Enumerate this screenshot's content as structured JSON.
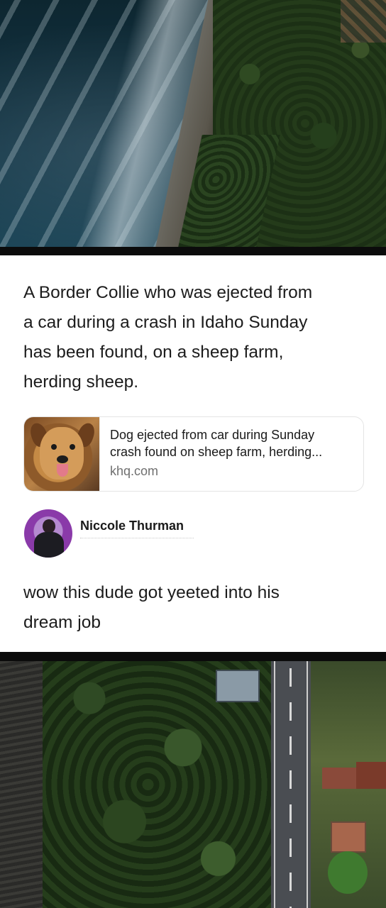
{
  "post": {
    "text_lines": [
      "A Border Collie who was ejected from",
      "a car during a crash in Idaho Sunday",
      "has been found, on a sheep farm,",
      "herding sheep."
    ]
  },
  "link_preview": {
    "title_lines": [
      "Dog ejected from car during Sunday",
      "crash found on sheep farm, herding..."
    ],
    "domain": "khq.com",
    "thumbnail_icon": "dog-photo"
  },
  "reply": {
    "author_name": "Niccole Thurman",
    "avatar_icon": "profile-photo",
    "text_lines": [
      "wow this dude got yeeted into his",
      "dream job"
    ]
  },
  "background": {
    "top_photo": "aerial-coastline-photo",
    "bottom_photo": "aerial-road-palms-photo"
  }
}
